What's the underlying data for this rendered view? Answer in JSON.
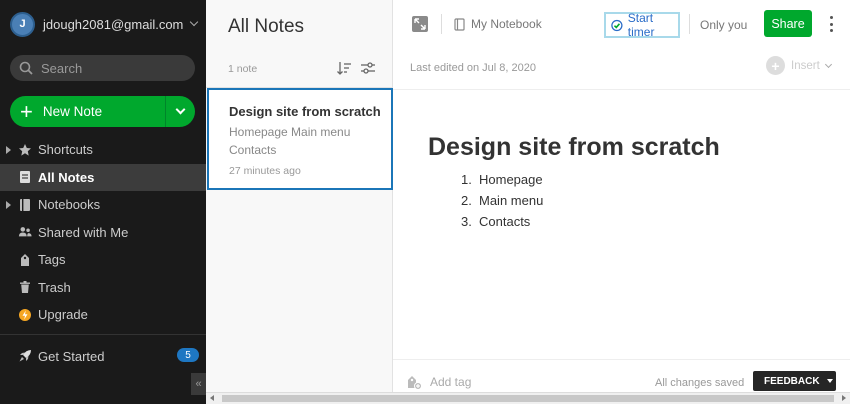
{
  "sidebar": {
    "account_email": "jdough2081@gmail.com",
    "avatar_initials": "J",
    "search_placeholder": "Search",
    "new_note_label": "New Note",
    "items": [
      {
        "label": "Shortcuts",
        "icon": "star-icon",
        "expandable": true,
        "active": false
      },
      {
        "label": "All Notes",
        "icon": "note-icon",
        "expandable": false,
        "active": true
      },
      {
        "label": "Notebooks",
        "icon": "notebook-icon",
        "expandable": true,
        "active": false
      },
      {
        "label": "Shared with Me",
        "icon": "people-icon",
        "expandable": false,
        "active": false
      },
      {
        "label": "Tags",
        "icon": "tag-icon",
        "expandable": false,
        "active": false
      },
      {
        "label": "Trash",
        "icon": "trash-icon",
        "expandable": false,
        "active": false
      },
      {
        "label": "Upgrade",
        "icon": "upgrade-icon",
        "expandable": false,
        "active": false
      }
    ],
    "get_started_label": "Get Started",
    "get_started_badge": "5",
    "collapse_glyph": "«"
  },
  "note_list": {
    "title": "All Notes",
    "count": "1 note",
    "notes": [
      {
        "title": "Design site from scratch",
        "snippet": "Homepage Main menu Contacts",
        "time": "27 minutes ago"
      }
    ]
  },
  "editor": {
    "notebook": "My Notebook",
    "start_timer": "Start timer",
    "sharing": "Only you",
    "share_label": "Share",
    "last_edited": "Last edited on Jul 8, 2020",
    "insert_label": "Insert",
    "doc_title": "Design site from scratch",
    "list_items": [
      {
        "num": "1.",
        "text": "Homepage"
      },
      {
        "num": "2.",
        "text": "Main menu"
      },
      {
        "num": "3.",
        "text": "Contacts"
      }
    ],
    "add_tag_placeholder": "Add tag",
    "saved_status": "All changes saved",
    "feedback_label": "FEEDBACK"
  },
  "colors": {
    "sidebar_bg": "#1a1a1a",
    "accent_green": "#00a82d",
    "selection_blue": "#1b76b8",
    "badge_blue": "#1e77c2"
  }
}
